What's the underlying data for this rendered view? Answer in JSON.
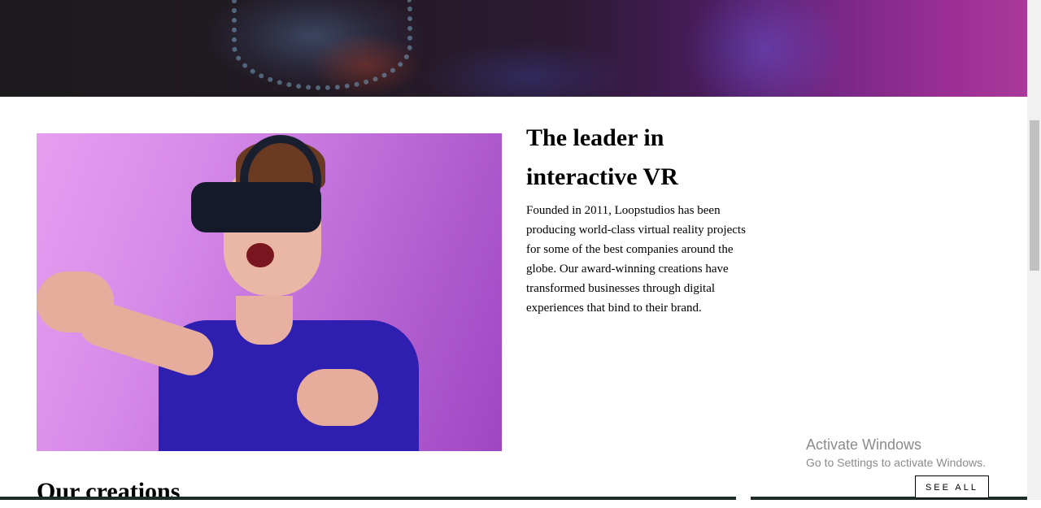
{
  "about": {
    "title_line1": "The leader in",
    "title_line2": "interactive VR",
    "body": "Founded in 2011, Loopstudios has been producing world-class virtual reality projects for some of the best companies around the globe. Our award-winning creations have transformed businesses through digital experiences that bind to their brand."
  },
  "creations": {
    "heading": "Our creations",
    "see_all_label": "SEE ALL"
  },
  "os_watermark": {
    "line1": "Activate Windows",
    "line2": "Go to Settings to activate Windows."
  },
  "colors": {
    "hero_magenta": "#a93a9a",
    "photo_purple": "#bd6cd8",
    "text": "#000000"
  }
}
